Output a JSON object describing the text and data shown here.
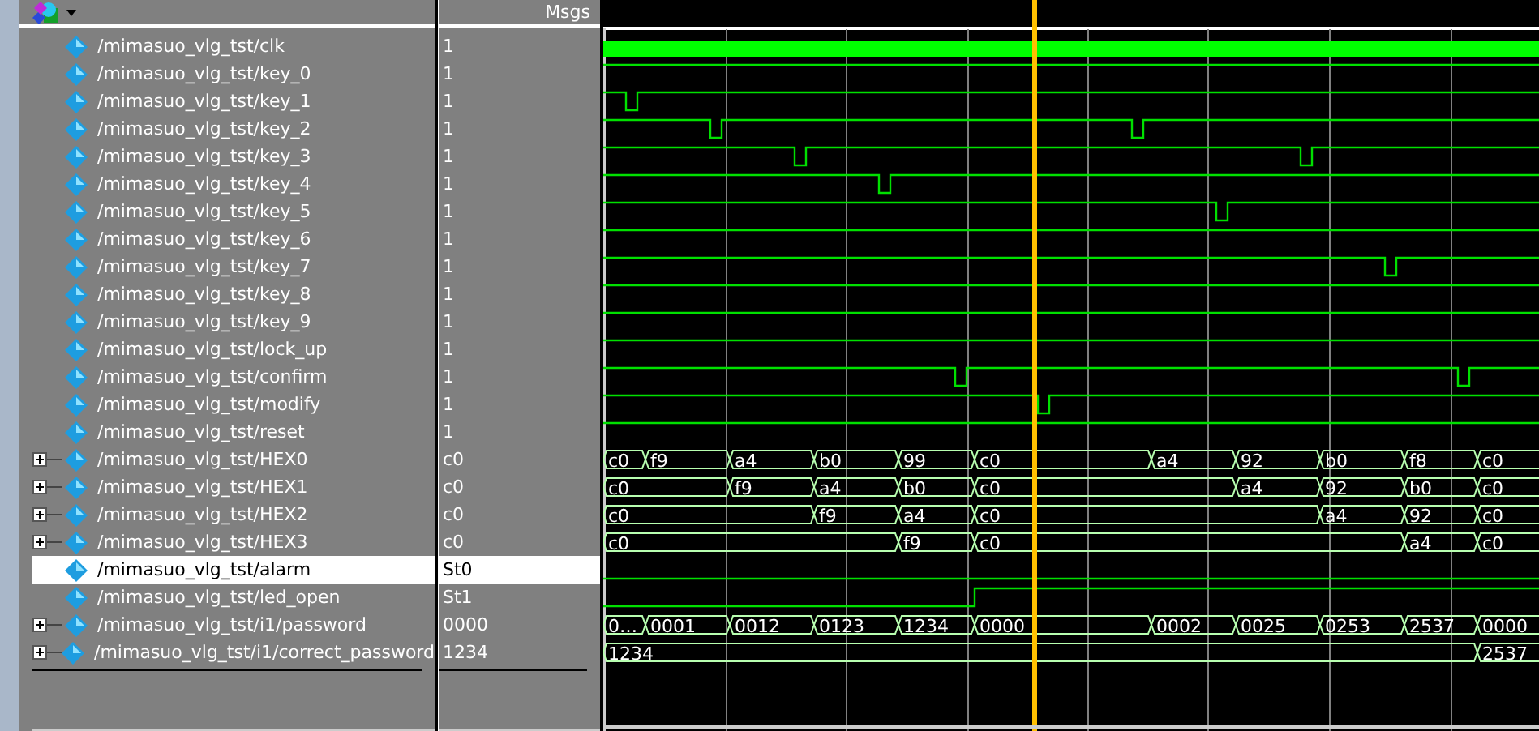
{
  "header": {
    "value_column": "Msgs"
  },
  "signals": [
    {
      "name": "/mimasuo_vlg_tst/clk",
      "value": "1",
      "kind": "clock",
      "expandable": false,
      "selected": false
    },
    {
      "name": "/mimasuo_vlg_tst/key_0",
      "value": "1",
      "kind": "bit",
      "expandable": false,
      "selected": false
    },
    {
      "name": "/mimasuo_vlg_tst/key_1",
      "value": "1",
      "kind": "bit",
      "expandable": false,
      "selected": false
    },
    {
      "name": "/mimasuo_vlg_tst/key_2",
      "value": "1",
      "kind": "bit",
      "expandable": false,
      "selected": false
    },
    {
      "name": "/mimasuo_vlg_tst/key_3",
      "value": "1",
      "kind": "bit",
      "expandable": false,
      "selected": false
    },
    {
      "name": "/mimasuo_vlg_tst/key_4",
      "value": "1",
      "kind": "bit",
      "expandable": false,
      "selected": false
    },
    {
      "name": "/mimasuo_vlg_tst/key_5",
      "value": "1",
      "kind": "bit",
      "expandable": false,
      "selected": false
    },
    {
      "name": "/mimasuo_vlg_tst/key_6",
      "value": "1",
      "kind": "bit",
      "expandable": false,
      "selected": false
    },
    {
      "name": "/mimasuo_vlg_tst/key_7",
      "value": "1",
      "kind": "bit",
      "expandable": false,
      "selected": false
    },
    {
      "name": "/mimasuo_vlg_tst/key_8",
      "value": "1",
      "kind": "bit",
      "expandable": false,
      "selected": false
    },
    {
      "name": "/mimasuo_vlg_tst/key_9",
      "value": "1",
      "kind": "bit",
      "expandable": false,
      "selected": false
    },
    {
      "name": "/mimasuo_vlg_tst/lock_up",
      "value": "1",
      "kind": "bit",
      "expandable": false,
      "selected": false
    },
    {
      "name": "/mimasuo_vlg_tst/confirm",
      "value": "1",
      "kind": "bit",
      "expandable": false,
      "selected": false
    },
    {
      "name": "/mimasuo_vlg_tst/modify",
      "value": "1",
      "kind": "bit",
      "expandable": false,
      "selected": false
    },
    {
      "name": "/mimasuo_vlg_tst/reset",
      "value": "1",
      "kind": "bit",
      "expandable": false,
      "selected": false
    },
    {
      "name": "/mimasuo_vlg_tst/HEX0",
      "value": "c0",
      "kind": "bus",
      "expandable": true,
      "selected": false,
      "values": [
        "c0",
        "f9",
        "a4",
        "b0",
        "99",
        "c0",
        "a4",
        "92",
        "b0",
        "f8",
        "c0"
      ]
    },
    {
      "name": "/mimasuo_vlg_tst/HEX1",
      "value": "c0",
      "kind": "bus",
      "expandable": true,
      "selected": false,
      "values": [
        "c0",
        "f9",
        "a4",
        "b0",
        "c0",
        "a4",
        "92",
        "b0",
        "c0"
      ]
    },
    {
      "name": "/mimasuo_vlg_tst/HEX2",
      "value": "c0",
      "kind": "bus",
      "expandable": true,
      "selected": false,
      "values": [
        "c0",
        "f9",
        "a4",
        "c0",
        "a4",
        "92",
        "c0"
      ]
    },
    {
      "name": "/mimasuo_vlg_tst/HEX3",
      "value": "c0",
      "kind": "bus",
      "expandable": true,
      "selected": false,
      "values": [
        "c0",
        "f9",
        "c0",
        "a4",
        "c0"
      ]
    },
    {
      "name": "/mimasuo_vlg_tst/alarm",
      "value": "St0",
      "kind": "bit",
      "expandable": false,
      "selected": true
    },
    {
      "name": "/mimasuo_vlg_tst/led_open",
      "value": "St1",
      "kind": "bit",
      "expandable": false,
      "selected": false
    },
    {
      "name": "/mimasuo_vlg_tst/i1/password",
      "value": "0000",
      "kind": "bus",
      "expandable": true,
      "selected": false,
      "values": [
        "0…",
        "0001",
        "0012",
        "0123",
        "1234",
        "0000",
        "0002",
        "0025",
        "0253",
        "2537",
        "0000"
      ]
    },
    {
      "name": "/mimasuo_vlg_tst/i1/correct_password",
      "value": "1234",
      "kind": "bus",
      "expandable": true,
      "selected": false,
      "values": [
        "1234",
        "2537"
      ]
    }
  ]
}
